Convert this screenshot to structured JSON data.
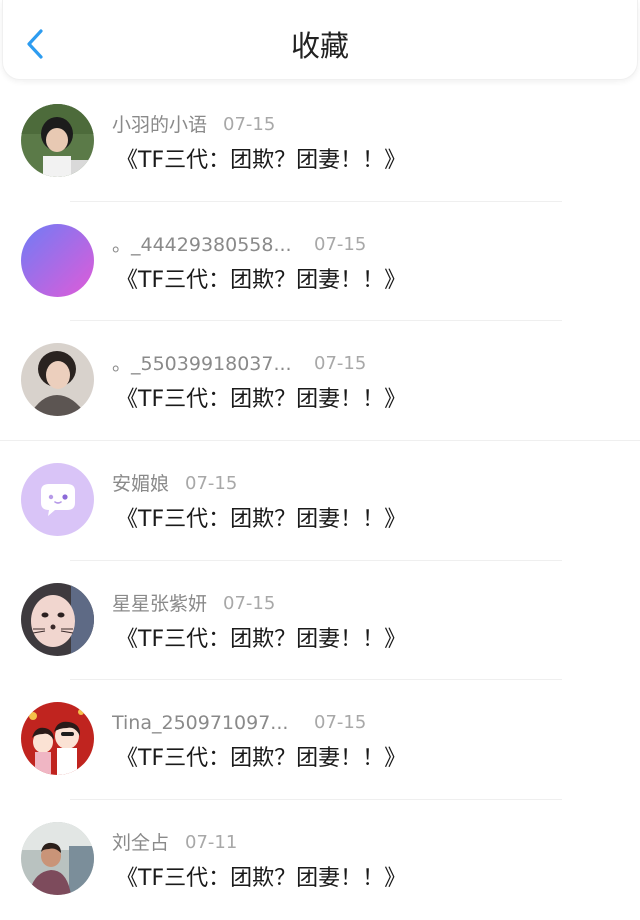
{
  "header": {
    "title": "收藏",
    "back_icon": "chevron-left-icon",
    "accent": "#2d9cf0"
  },
  "items": [
    {
      "name": "小羽的小语",
      "date": "07-15",
      "content": "《TF三代：团欺？团妻！！》",
      "avatar": "photo-avatar"
    },
    {
      "name": "。_44429380558...",
      "date": "07-15",
      "content": "《TF三代：团欺？团妻！！》",
      "avatar": "gradient-avatar"
    },
    {
      "name": "。_55039918037...",
      "date": "07-15",
      "content": "《TF三代：团欺？团妻！！》",
      "avatar": "photo-avatar"
    },
    {
      "name": "安媚娘",
      "date": "07-15",
      "content": "《TF三代：团欺？团妻！！》",
      "avatar": "chat-bubble-avatar"
    },
    {
      "name": "星星张紫妍",
      "date": "07-15",
      "content": "《TF三代：团欺？团妻！！》",
      "avatar": "photo-avatar"
    },
    {
      "name": "Tina_250971097...",
      "date": "07-15",
      "content": "《TF三代：团欺？团妻！！》",
      "avatar": "cartoon-avatar"
    },
    {
      "name": "刘全占",
      "date": "07-11",
      "content": "《TF三代：团欺？团妻！！》",
      "avatar": "photo-avatar"
    }
  ]
}
